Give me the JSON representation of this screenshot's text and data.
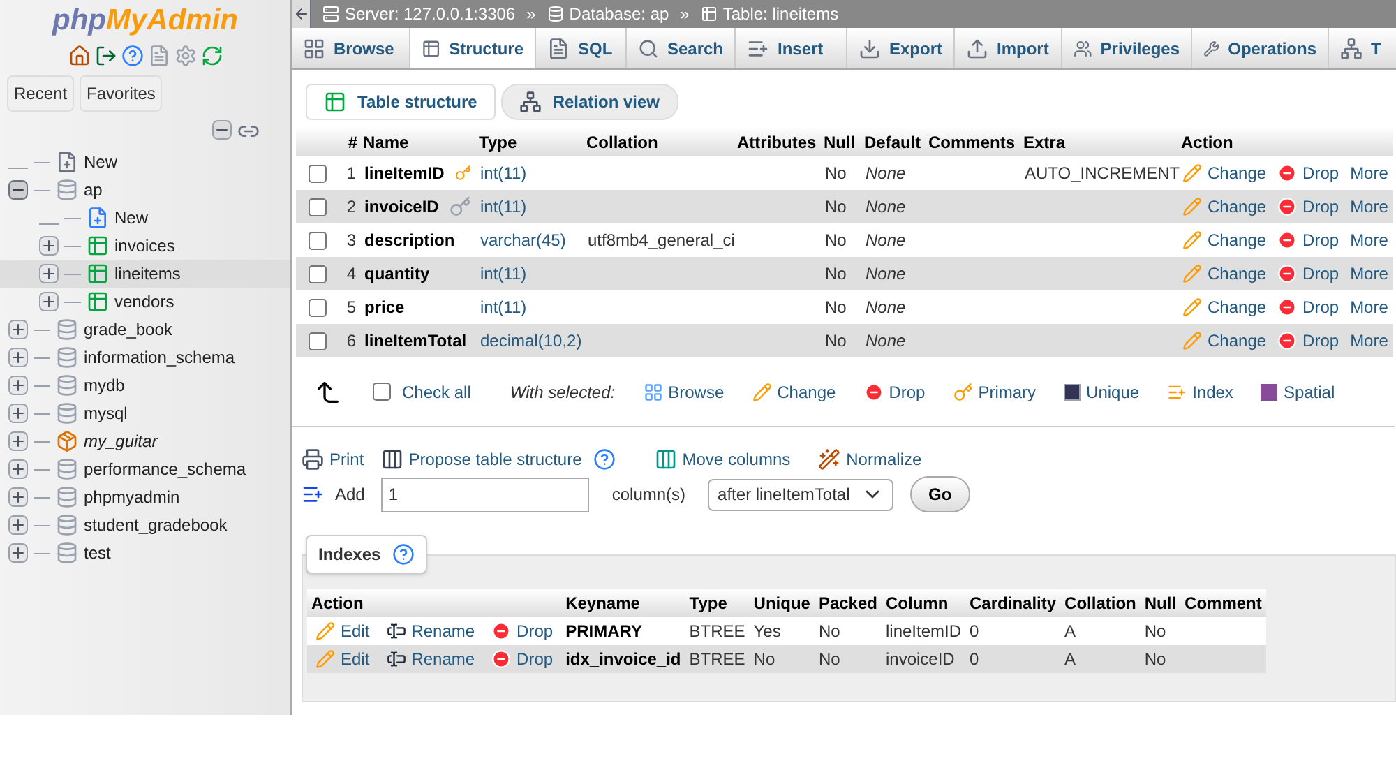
{
  "sidebar": {
    "logo": {
      "php": "php",
      "rest": "MyAdmin"
    },
    "tabs": [
      {
        "label": "Recent"
      },
      {
        "label": "Favorites"
      }
    ],
    "tree": [
      {
        "label": "New",
        "kind": "new",
        "selected": false
      },
      {
        "label": "ap",
        "kind": "database",
        "expanded": true,
        "selected": false,
        "children": [
          {
            "label": "New",
            "kind": "new_table",
            "selected": false
          },
          {
            "label": "invoices",
            "kind": "table",
            "expanded": false,
            "selected": false
          },
          {
            "label": "lineitems",
            "kind": "table",
            "expanded": false,
            "selected": true
          },
          {
            "label": "vendors",
            "kind": "table",
            "expanded": false,
            "selected": false
          }
        ]
      },
      {
        "label": "grade_book",
        "kind": "database",
        "expanded": false,
        "selected": false
      },
      {
        "label": "information_schema",
        "kind": "database",
        "expanded": false,
        "selected": false
      },
      {
        "label": "mydb",
        "kind": "database",
        "expanded": false,
        "selected": false
      },
      {
        "label": "mysql",
        "kind": "database",
        "expanded": false,
        "selected": false
      },
      {
        "label": "my_guitar",
        "kind": "package",
        "expanded": false,
        "selected": false
      },
      {
        "label": "performance_schema",
        "kind": "database",
        "expanded": false,
        "selected": false
      },
      {
        "label": "phpmyadmin",
        "kind": "database",
        "expanded": false,
        "selected": false
      },
      {
        "label": "student_gradebook",
        "kind": "database",
        "expanded": false,
        "selected": false
      },
      {
        "label": "test",
        "kind": "database",
        "expanded": false,
        "selected": false
      }
    ]
  },
  "breadcrumb": [
    {
      "label": "Server: 127.0.0.1:3306",
      "kind": "server"
    },
    {
      "label": "Database: ap",
      "kind": "database"
    },
    {
      "label": "Table: lineitems",
      "kind": "table"
    }
  ],
  "breadcrumb_separator": "»",
  "tabs": [
    {
      "label": "Browse",
      "selected": false
    },
    {
      "label": "Structure",
      "selected": true
    },
    {
      "label": "SQL",
      "selected": false
    },
    {
      "label": "Search",
      "selected": false
    },
    {
      "label": "Insert",
      "selected": false
    },
    {
      "label": "Export",
      "selected": false
    },
    {
      "label": "Import",
      "selected": false
    },
    {
      "label": "Privileges",
      "selected": false
    },
    {
      "label": "Operations",
      "selected": false
    },
    {
      "label": "T",
      "selected": false
    }
  ],
  "subtabs": [
    {
      "label": "Table structure",
      "selected": true
    },
    {
      "label": "Relation view",
      "selected": false
    }
  ],
  "table": {
    "columns": [
      "#",
      "Name",
      "Type",
      "Collation",
      "Attributes",
      "Null",
      "Default",
      "Comments",
      "Extra",
      "Action"
    ],
    "rows": [
      {
        "num": "1",
        "name": "lineItemID",
        "kind": "primary",
        "type": "int(11)",
        "null": "No",
        "default": "None",
        "extra": "AUTO_INCREMENT",
        "checked": false,
        "actions": [
          "Change",
          "Drop",
          "More"
        ]
      },
      {
        "num": "2",
        "name": "invoiceID",
        "kind": "indexed",
        "type": "int(11)",
        "null": "No",
        "default": "None",
        "checked": false,
        "actions": [
          "Change",
          "Drop",
          "More"
        ]
      },
      {
        "num": "3",
        "name": "description",
        "kind": "plain",
        "type": "varchar(45)",
        "collation": "utf8mb4_general_ci",
        "null": "No",
        "default": "None",
        "checked": false,
        "actions": [
          "Change",
          "Drop",
          "More"
        ]
      },
      {
        "num": "4",
        "name": "quantity",
        "kind": "plain",
        "type": "int(11)",
        "null": "No",
        "default": "None",
        "checked": false,
        "actions": [
          "Change",
          "Drop",
          "More"
        ]
      },
      {
        "num": "5",
        "name": "price",
        "kind": "plain",
        "type": "int(11)",
        "null": "No",
        "default": "None",
        "checked": false,
        "actions": [
          "Change",
          "Drop",
          "More"
        ]
      },
      {
        "num": "6",
        "name": "lineItemTotal",
        "kind": "plain",
        "type": "decimal(10,2)",
        "null": "No",
        "default": "None",
        "checked": false,
        "actions": [
          "Change",
          "Drop",
          "More"
        ]
      }
    ]
  },
  "bulk": {
    "check_all": "Check all",
    "checked": false,
    "with_selected": "With selected:",
    "actions": [
      "Browse",
      "Change",
      "Drop",
      "Primary",
      "Unique",
      "Index",
      "Spatial"
    ]
  },
  "tools": [
    "Print",
    "Propose table structure",
    "Move columns",
    "Normalize"
  ],
  "add": {
    "label": "Add",
    "value": "1",
    "unit": "column(s)",
    "position": "after lineItemTotal",
    "go": "Go"
  },
  "indexes": {
    "title": "Indexes",
    "columns": [
      "Action",
      "Keyname",
      "Type",
      "Unique",
      "Packed",
      "Column",
      "Cardinality",
      "Collation",
      "Null",
      "Comment"
    ],
    "rows": [
      {
        "actions": [
          "Edit",
          "Rename",
          "Drop"
        ],
        "keyname": "PRIMARY",
        "type": "BTREE",
        "unique": "Yes",
        "packed": "No",
        "column": "lineItemID",
        "cardinality": "0",
        "collation": "A",
        "null": "No"
      },
      {
        "actions": [
          "Edit",
          "Rename",
          "Drop"
        ],
        "keyname": "idx_invoice_id",
        "type": "BTREE",
        "unique": "No",
        "packed": "No",
        "column": "invoiceID",
        "cardinality": "0",
        "collation": "A",
        "null": "No"
      }
    ]
  }
}
